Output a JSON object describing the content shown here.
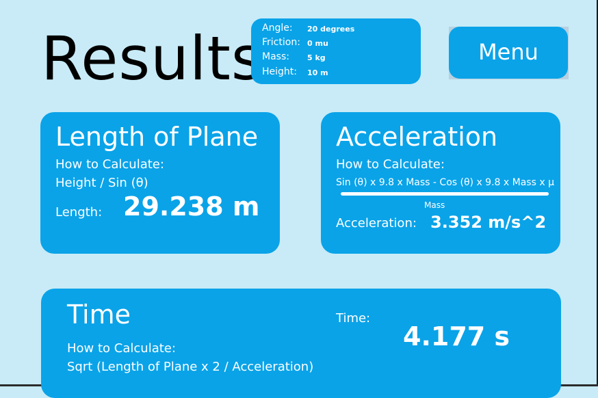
{
  "header": {
    "title": "Results:",
    "menu_label": "Menu"
  },
  "params": [
    {
      "key": "Angle:",
      "value": "20 degrees"
    },
    {
      "key": "Friction:",
      "value": "0 mu"
    },
    {
      "key": "Mass:",
      "value": "5 kg"
    },
    {
      "key": "Height:",
      "value": "10 m"
    }
  ],
  "length_card": {
    "title": "Length of Plane",
    "how_label": "How to Calculate:",
    "formula": "Height / Sin (θ)",
    "result_label": "Length:",
    "result_value": "29.238 m"
  },
  "accel_card": {
    "title": "Acceleration",
    "how_label": "How to Calculate:",
    "numerator": "Sin (θ) x 9.8 x Mass - Cos (θ) x 9.8 x Mass x μ",
    "denominator": "Mass",
    "result_label": "Acceleration:",
    "result_value": "3.352 m/s^2"
  },
  "time_card": {
    "title": "Time",
    "how_label": "How to Calculate:",
    "formula": "Sqrt (Length of Plane x 2 / Acceleration)",
    "result_label": "Time:",
    "result_value": "4.177 s"
  }
}
